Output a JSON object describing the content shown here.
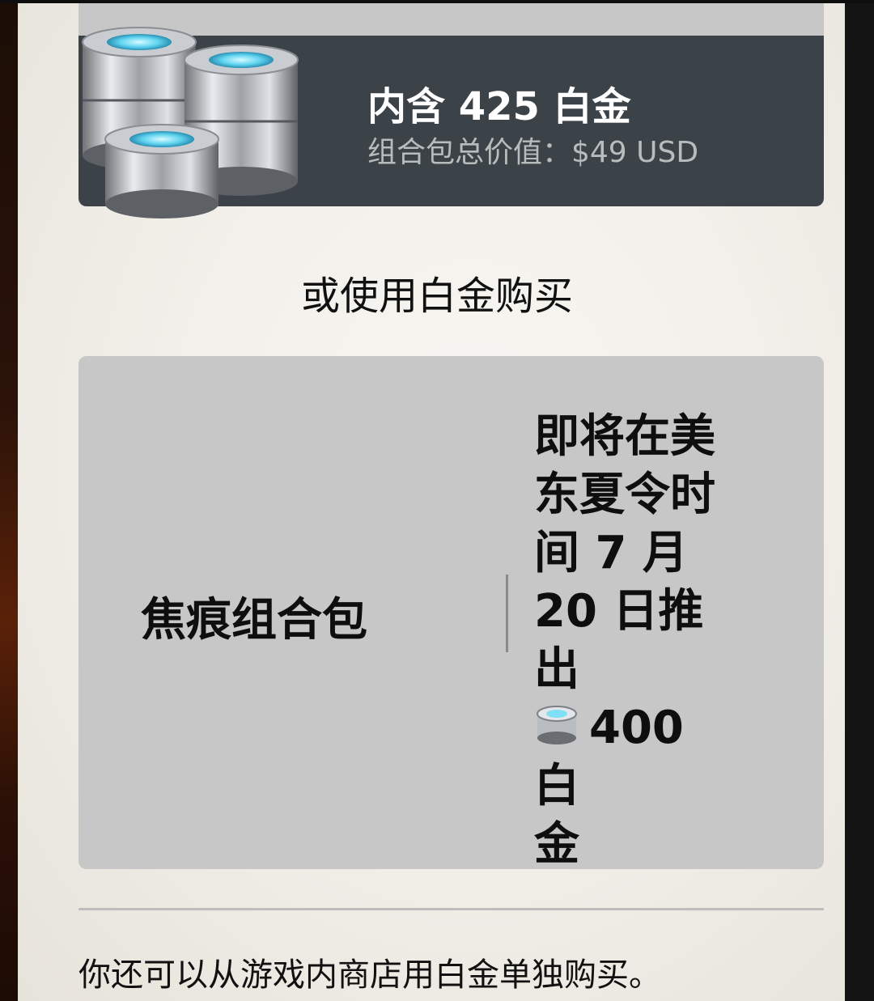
{
  "promo": {
    "title": "内含 425 白金",
    "subtitle": "组合包总价值：$49 USD",
    "image_icon": "platinum-stack-icon"
  },
  "alternate": {
    "heading": "或使用白金购买"
  },
  "pack": {
    "name": "焦痕组合包",
    "release_line1": "即将在美",
    "release_line2": "东夏令时",
    "release_line3": "间 7 月",
    "release_line4": "20 日推",
    "release_line5": "出",
    "price_icon": "platinum-icon",
    "price_text": "400 白",
    "price_text2": "金"
  },
  "footer": {
    "text": "你还可以从游戏内商店用白金单独购买。"
  },
  "colors": {
    "accent": "#e0642c",
    "promo_bg": "#3c4348",
    "pack_bg": "#c7c7c7",
    "page_bg": "#f2f0ea"
  }
}
